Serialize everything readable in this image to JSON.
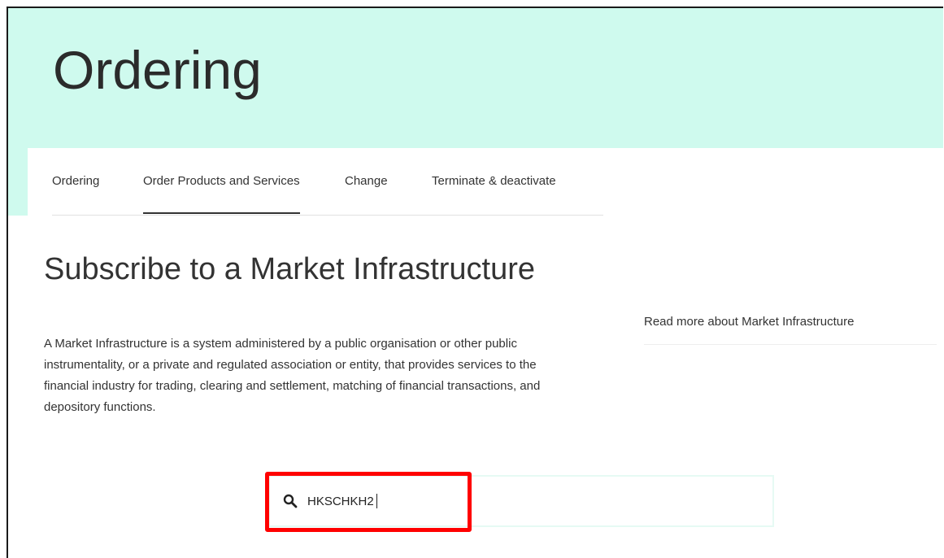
{
  "hero": {
    "title": "Ordering"
  },
  "tabs": [
    {
      "label": "Ordering",
      "active": false
    },
    {
      "label": "Order Products and Services",
      "active": true
    },
    {
      "label": "Change",
      "active": false
    },
    {
      "label": "Terminate & deactivate",
      "active": false
    }
  ],
  "main": {
    "heading": "Subscribe to a Market Infrastructure",
    "description": "A Market Infrastructure is a system administered by a public organisation or other public instrumentality, or a private and regulated association or entity, that provides services to the financial industry for trading, clearing and settlement, matching of financial transactions, and depository functions.",
    "read_more": "Read more about Market Infrastructure"
  },
  "search": {
    "value": "HKSCHKH2",
    "icon": "search-icon"
  },
  "colors": {
    "hero_bg": "#cffaee",
    "highlight": "#ff0000",
    "search_border": "#e6faf4"
  }
}
